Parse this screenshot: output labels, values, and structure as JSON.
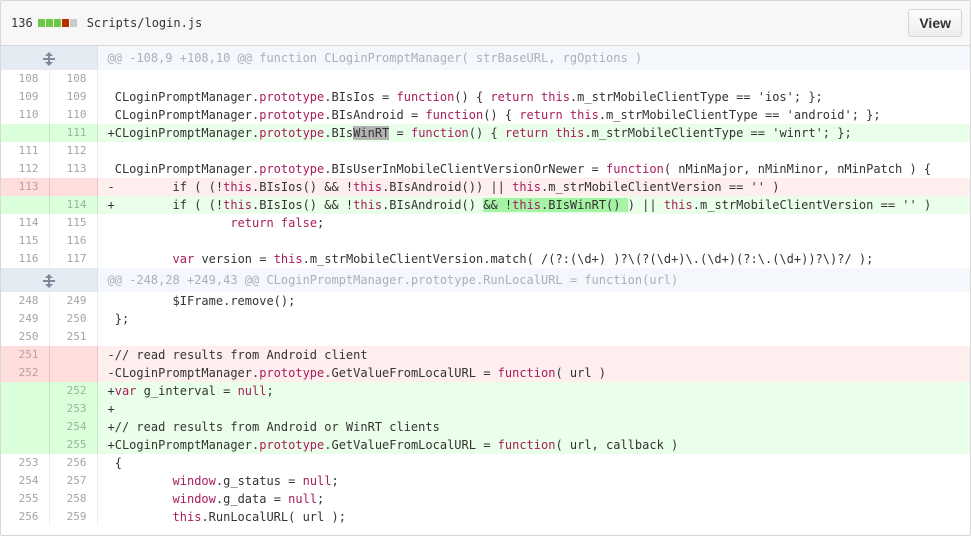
{
  "file": {
    "change_count": "136",
    "path": "Scripts/login.js",
    "view_label": "View",
    "diffstat_colors": [
      "#6cc644",
      "#6cc644",
      "#6cc644",
      "#bd2c00",
      "#cccccc"
    ]
  },
  "hunks": [
    {
      "header": "@@ -108,9 +108,10 @@ function CLoginPromptManager( strBaseURL, rgOptions )"
    },
    {
      "header": "@@ -248,28 +249,43 @@ CLoginPromptManager.prototype.RunLocalURL = function(url)"
    }
  ],
  "lines": [
    {
      "old": "108",
      "new": "108",
      "type": "ctx",
      "text": ""
    },
    {
      "old": "109",
      "new": "109",
      "type": "ctx",
      "text": " CLoginPromptManager.prototype.BIsIos = function() { return this.m_strMobileClientType == 'ios'; };"
    },
    {
      "old": "110",
      "new": "110",
      "type": "ctx",
      "text": " CLoginPromptManager.prototype.BIsAndroid = function() { return this.m_strMobileClientType == 'android'; };"
    },
    {
      "old": "",
      "new": "111",
      "type": "add",
      "text": "+CLoginPromptManager.prototype.BIsWinRT = function() { return this.m_strMobileClientType == 'winrt'; };"
    },
    {
      "old": "111",
      "new": "112",
      "type": "ctx",
      "text": ""
    },
    {
      "old": "112",
      "new": "113",
      "type": "ctx",
      "text": " CLoginPromptManager.prototype.BIsUserInMobileClientVersionOrNewer = function( nMinMajor, nMinMinor, nMinPatch ) {"
    },
    {
      "old": "113",
      "new": "",
      "type": "del",
      "text": "-        if ( (!this.BIsIos() && !this.BIsAndroid()) || this.m_strMobileClientVersion == '' )"
    },
    {
      "old": "",
      "new": "114",
      "type": "add",
      "text": "+        if ( (!this.BIsIos() && !this.BIsAndroid() && !this.BIsWinRT() ) || this.m_strMobileClientVersion == '' )"
    },
    {
      "old": "114",
      "new": "115",
      "type": "ctx",
      "text": "                 return false;"
    },
    {
      "old": "115",
      "new": "116",
      "type": "ctx",
      "text": ""
    },
    {
      "old": "116",
      "new": "117",
      "type": "ctx",
      "text": "         var version = this.m_strMobileClientVersion.match( /(?:(\\d+) )?\\(?(\\d+)\\.(\\d+)(?:\\.(\\d+))?\\)?/ );"
    },
    {
      "old": "248",
      "new": "249",
      "type": "ctx",
      "text": "         $IFrame.remove();"
    },
    {
      "old": "249",
      "new": "250",
      "type": "ctx",
      "text": " };"
    },
    {
      "old": "250",
      "new": "251",
      "type": "ctx",
      "text": ""
    },
    {
      "old": "251",
      "new": "",
      "type": "del",
      "text": "-// read results from Android client"
    },
    {
      "old": "252",
      "new": "",
      "type": "del",
      "text": "-CLoginPromptManager.prototype.GetValueFromLocalURL = function( url )"
    },
    {
      "old": "",
      "new": "252",
      "type": "add",
      "text": "+var g_interval = null;"
    },
    {
      "old": "",
      "new": "253",
      "type": "add",
      "text": "+"
    },
    {
      "old": "",
      "new": "254",
      "type": "add",
      "text": "+// read results from Android or WinRT clients"
    },
    {
      "old": "",
      "new": "255",
      "type": "add",
      "text": "+CLoginPromptManager.prototype.GetValueFromLocalURL = function( url, callback )"
    },
    {
      "old": "253",
      "new": "256",
      "type": "ctx",
      "text": " {"
    },
    {
      "old": "254",
      "new": "257",
      "type": "ctx",
      "text": "         window.g_status = null;"
    },
    {
      "old": "255",
      "new": "258",
      "type": "ctx",
      "text": "         window.g_data = null;"
    },
    {
      "old": "256",
      "new": "259",
      "type": "ctx",
      "text": "         this.RunLocalURL( url );"
    }
  ]
}
